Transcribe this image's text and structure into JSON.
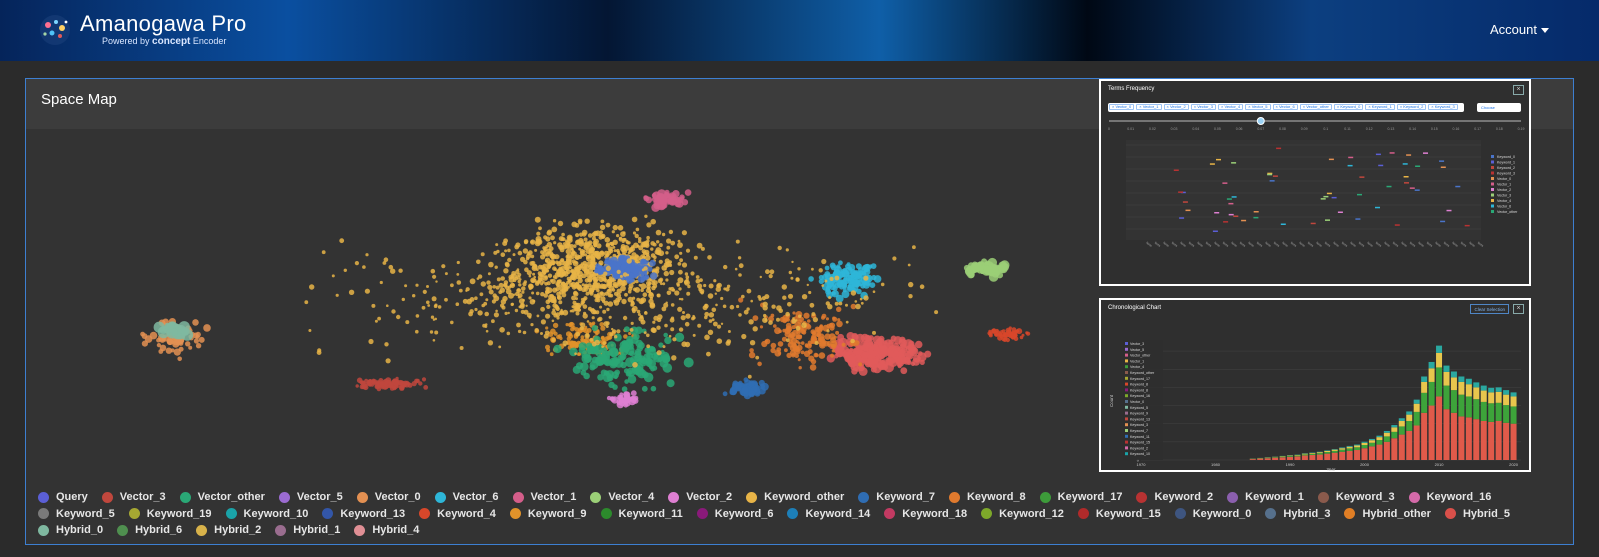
{
  "header": {
    "app_title": "Amanogawa Pro",
    "powered_by": "Powered by",
    "powered_brand": "concept",
    "powered_product": "Encoder",
    "account_label": "Account"
  },
  "panel": {
    "title": "Space Map"
  },
  "terms_frequency": {
    "title": "Terms Frequency",
    "chips": [
      "Vector_0",
      "Vector_1",
      "Vector_2",
      "Vector_3",
      "Vector_4",
      "Vector_5",
      "Vector_6",
      "Vector_other",
      "Keyword_0",
      "Keyword_1",
      "Keyword_2",
      "Keyword_3"
    ],
    "choose_label": "Choose",
    "slider_ticks": [
      "0",
      "0.01",
      "0.02",
      "0.03",
      "0.04",
      "0.05",
      "0.06",
      "0.07",
      "0.08",
      "0.09",
      "0.1",
      "0.11",
      "0.12",
      "0.13",
      "0.14",
      "0.15",
      "0.16",
      "0.17",
      "0.18",
      "0.19"
    ],
    "slider_value": 0.07,
    "legend": [
      "Keyword_0",
      "Keyword_1",
      "Keyword_2",
      "Keyword_3",
      "Vector_0",
      "Vector_1",
      "Vector_2",
      "Vector_3",
      "Vector_4",
      "Vector_6",
      "Vector_other"
    ]
  },
  "chronological": {
    "title": "Chronological Chart",
    "clear_label": "Clear Selection",
    "legend": [
      "Vector_3",
      "Vector_5",
      "Vector_other",
      "Vector_1",
      "Vector_4",
      "Keyword_other",
      "Keyword_17",
      "Keyword_8",
      "Keyword_8",
      "Keyword_16",
      "Vector_0",
      "Keyword_5",
      "Keyword_9",
      "Keyword_13",
      "Keyword_3",
      "Keyword_7",
      "Keyword_11",
      "Keyword_15",
      "Keyword_2",
      "Keyword_10"
    ]
  },
  "chart_data": [
    {
      "type": "scatter",
      "title": "Space Map",
      "series_names": [
        "Query",
        "Vector_3",
        "Vector_other",
        "Vector_5",
        "Vector_0",
        "Vector_6",
        "Vector_1",
        "Vector_4",
        "Vector_2",
        "Keyword_other",
        "Keyword_7",
        "Keyword_8",
        "Keyword_17",
        "Keyword_2",
        "Keyword_1",
        "Keyword_3",
        "Keyword_16",
        "Keyword_5",
        "Keyword_19",
        "Keyword_10",
        "Keyword_13",
        "Keyword_4",
        "Keyword_9",
        "Keyword_11",
        "Keyword_6",
        "Keyword_14",
        "Keyword_18",
        "Keyword_12",
        "Keyword_15",
        "Keyword_0",
        "Hybrid_3",
        "Hybrid_other",
        "Hybrid_5",
        "Hybrid_0",
        "Hybrid_6",
        "Hybrid_2",
        "Hybrid_1",
        "Hybrid_4"
      ]
    },
    {
      "type": "bar",
      "title": "Chronological Chart",
      "xlabel": "Year",
      "ylabel": "Count",
      "ylim": [
        0,
        1300
      ],
      "y_ticks": [
        0,
        200,
        400,
        600,
        800,
        1000,
        1200
      ],
      "x_ticks": [
        "1970",
        "1980",
        "1990",
        "2000",
        "2010",
        "2020"
      ],
      "x": [
        1985,
        1986,
        1987,
        1988,
        1989,
        1990,
        1991,
        1992,
        1993,
        1994,
        1995,
        1996,
        1997,
        1998,
        1999,
        2000,
        2001,
        2002,
        2003,
        2004,
        2005,
        2006,
        2007,
        2008,
        2009,
        2010,
        2011,
        2012,
        2013,
        2014,
        2015,
        2016,
        2017,
        2018,
        2019,
        2020
      ],
      "stacked": true,
      "series": [
        {
          "name": "Vector_3",
          "values": [
            10,
            15,
            20,
            25,
            30,
            35,
            40,
            50,
            55,
            60,
            70,
            80,
            90,
            100,
            110,
            130,
            150,
            170,
            200,
            240,
            280,
            320,
            380,
            520,
            600,
            700,
            560,
            520,
            480,
            470,
            450,
            430,
            420,
            430,
            410,
            400
          ]
        },
        {
          "name": "Vector_other",
          "values": [
            3,
            4,
            5,
            6,
            8,
            9,
            10,
            12,
            14,
            16,
            18,
            20,
            24,
            28,
            30,
            35,
            40,
            50,
            60,
            70,
            90,
            110,
            150,
            220,
            260,
            320,
            260,
            250,
            240,
            230,
            220,
            210,
            205,
            200,
            195,
            190
          ]
        },
        {
          "name": "Keyword_other",
          "values": [
            2,
            3,
            3,
            4,
            5,
            5,
            6,
            8,
            9,
            10,
            12,
            14,
            16,
            18,
            20,
            24,
            28,
            32,
            40,
            50,
            60,
            70,
            90,
            120,
            150,
            160,
            150,
            140,
            140,
            135,
            130,
            125,
            120,
            120,
            115,
            110
          ]
        },
        {
          "name": "Vector_4",
          "values": [
            1,
            1,
            2,
            2,
            2,
            3,
            3,
            4,
            4,
            5,
            6,
            6,
            8,
            9,
            10,
            12,
            14,
            16,
            20,
            25,
            30,
            35,
            45,
            60,
            70,
            80,
            70,
            65,
            60,
            60,
            55,
            55,
            50,
            50,
            50,
            45
          ]
        }
      ]
    }
  ]
}
